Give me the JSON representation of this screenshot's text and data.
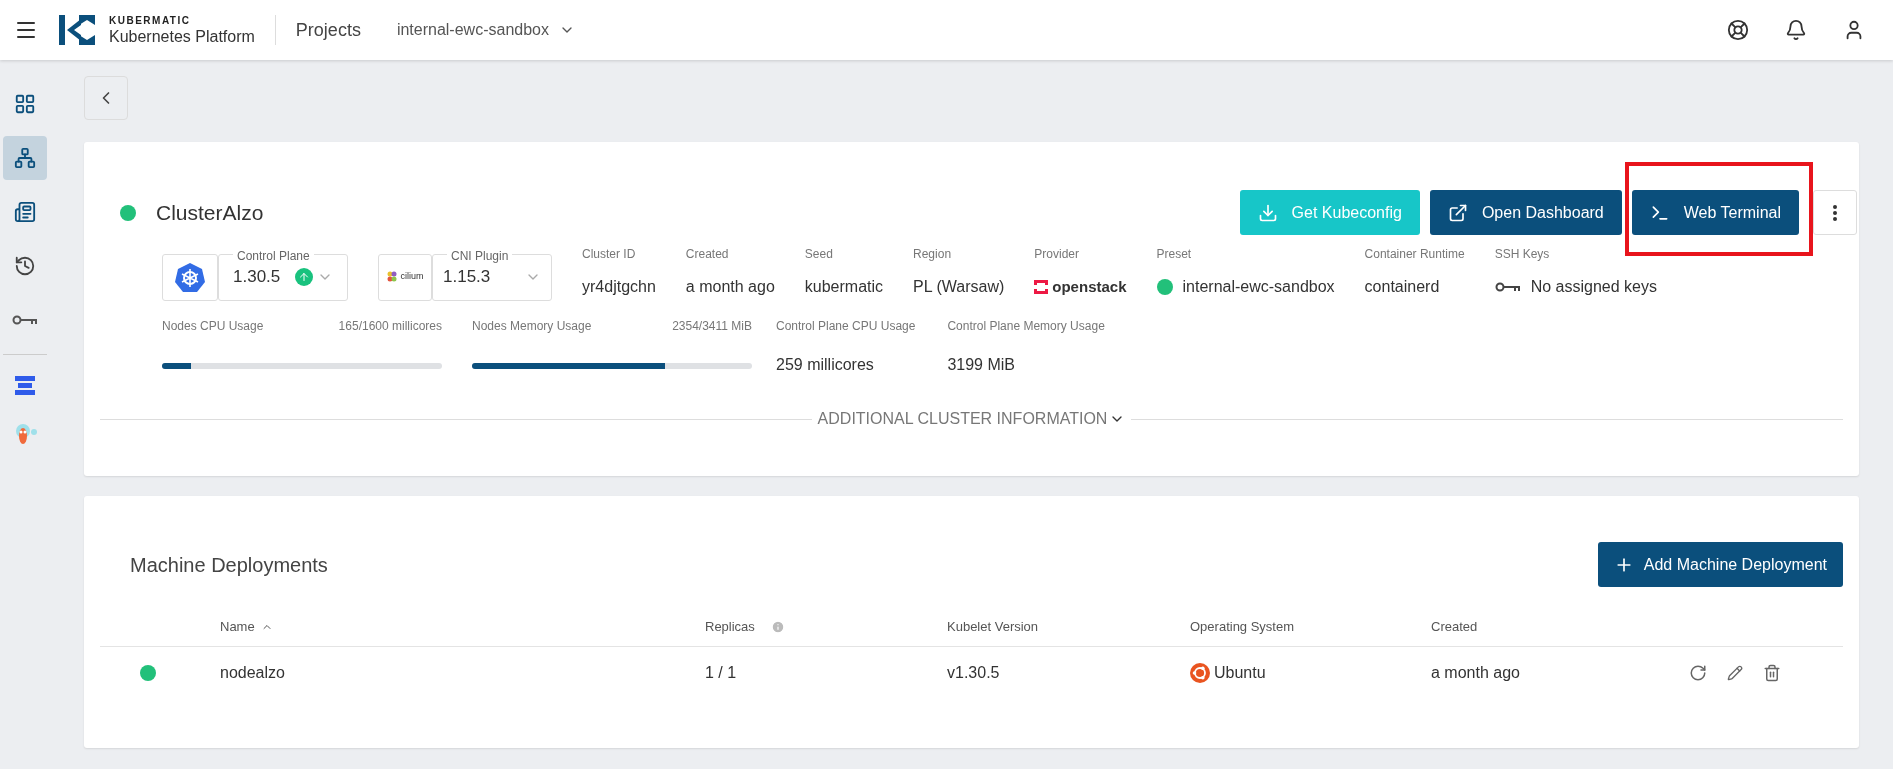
{
  "header": {
    "brand_top": "KUBERMATIC",
    "brand_bottom": "Kubernetes Platform",
    "nav_link": "Projects",
    "project": "internal-ewc-sandbox"
  },
  "sidebar": {
    "items": [
      {
        "kind": "grid",
        "selected": false
      },
      {
        "kind": "tree",
        "selected": true
      },
      {
        "kind": "form",
        "selected": false
      },
      {
        "kind": "history",
        "selected": false
      },
      {
        "kind": "key",
        "selected": false
      }
    ],
    "apps": [
      {
        "kind": "stack"
      },
      {
        "kind": "mascot"
      }
    ]
  },
  "cluster": {
    "name": "ClusterAlzo",
    "color": "#22c07a",
    "actions": [
      {
        "label": "Get Kubeconfig",
        "kind": "download"
      },
      {
        "label": "Open Dashboard",
        "kind": "open"
      },
      {
        "label": "Web Terminal",
        "kind": "terminal"
      }
    ],
    "control_plane": {
      "label": "Control Plane",
      "version": "1.30.5",
      "upgrade_available": true
    },
    "cni": {
      "label": "CNI Plugin",
      "logo_text": "cilium",
      "version": "1.15.3"
    },
    "info": [
      {
        "label": "Cluster ID",
        "value": "yr4djtgchn",
        "kind": "text"
      },
      {
        "label": "Created",
        "value": "a month ago",
        "kind": "text"
      },
      {
        "label": "Seed",
        "value": "kubermatic",
        "kind": "text"
      },
      {
        "label": "Region",
        "value": "PL (Warsaw)",
        "kind": "text"
      },
      {
        "label": "Provider",
        "value": "openstack",
        "kind": "provider"
      },
      {
        "label": "Preset",
        "value": "internal-ewc-sandbox",
        "kind": "preset"
      },
      {
        "label": "Container Runtime",
        "value": "containerd",
        "kind": "text"
      },
      {
        "label": "SSH Keys",
        "value": "No assigned keys",
        "kind": "keys"
      }
    ],
    "usage": [
      {
        "label": "Nodes CPU Usage",
        "reading": "165/1600 millicores",
        "level": 0.103,
        "kind": "bar"
      },
      {
        "label": "Nodes Memory Usage",
        "reading": "2354/3411 MiB",
        "level": 0.69,
        "kind": "bar"
      },
      {
        "label": "Control Plane CPU Usage",
        "reading": "259 millicores",
        "kind": "value"
      },
      {
        "label": "Control Plane Memory Usage",
        "reading": "3199 MiB",
        "kind": "value"
      }
    ],
    "more_info": "ADDITIONAL CLUSTER INFORMATION"
  },
  "machine_deployments": {
    "title": "Machine Deployments",
    "add_button": "Add Machine Deployment",
    "columns": [
      {
        "label": "Name",
        "sorted": true,
        "info": false
      },
      {
        "label": "Replicas",
        "sorted": false,
        "info": true
      },
      {
        "label": "Kubelet Version",
        "sorted": false,
        "info": false
      },
      {
        "label": "Operating System",
        "sorted": false,
        "info": false
      },
      {
        "label": "Created",
        "sorted": false,
        "info": false
      }
    ],
    "rows": [
      {
        "color": "#22c07a",
        "name": "nodealzo",
        "replicas": "1 / 1",
        "kubelet": "v1.30.5",
        "os": "Ubuntu",
        "created": "a month ago"
      }
    ]
  }
}
